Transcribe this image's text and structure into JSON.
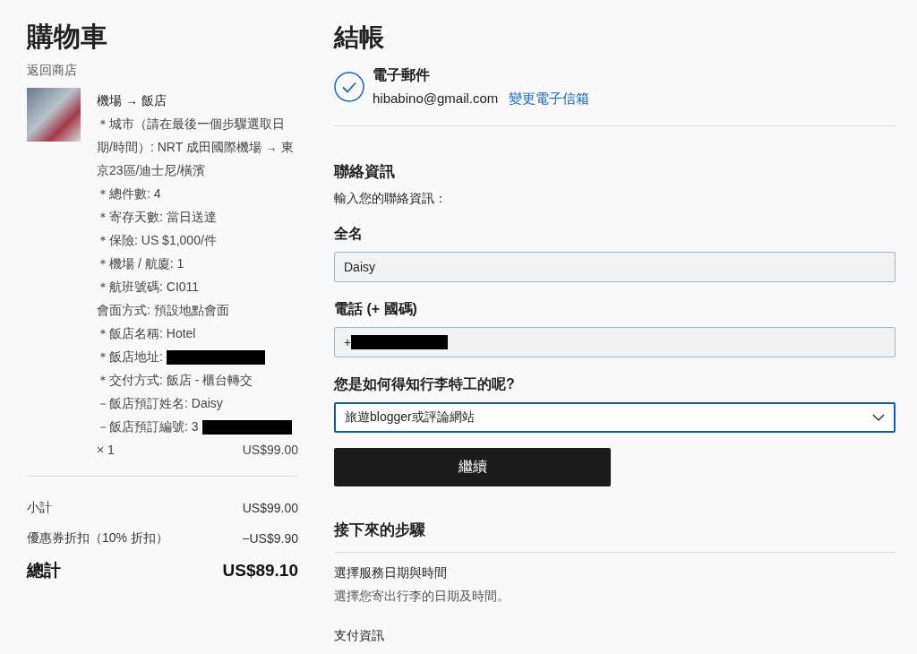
{
  "cart": {
    "title": "購物車",
    "back_link": "返回商店",
    "item": {
      "name": "機場 → 飯店",
      "details": [
        {
          "text": "＊城市（請在最後一個步驟選取日期/時間）: NRT 成田國際機場 → 東京23區/迪士尼/橫濱",
          "redacted": false
        },
        {
          "text": "＊總件數: 4",
          "redacted": false
        },
        {
          "text": "＊寄存天數: 當日送達",
          "redacted": false
        },
        {
          "text": "＊保險: US $1,000/件",
          "redacted": false
        },
        {
          "text": "＊機場 / 航廈: 1",
          "redacted": false
        },
        {
          "text": "＊航班號碼: CI011",
          "redacted": false
        },
        {
          "text": "會面方式: 預設地點會面",
          "redacted": false
        },
        {
          "text": "＊飯店名稱: Hotel",
          "redacted": false
        },
        {
          "text": "＊飯店地址:",
          "redacted": true
        },
        {
          "text": "＊交付方式: 飯店 - 櫃台轉交",
          "redacted": false
        },
        {
          "text": "－飯店預訂姓名: Daisy",
          "redacted": false
        },
        {
          "text": "－飯店預訂編號: 3",
          "redacted": true
        }
      ],
      "quantity": "× 1",
      "price": "US$99.00"
    },
    "summary": [
      {
        "kind": "normal",
        "label": "小計",
        "value": "US$99.00"
      },
      {
        "kind": "normal",
        "label": "優惠券折扣（10% 折扣）",
        "value": "−US$9.90"
      },
      {
        "kind": "total",
        "label": "總計",
        "value": "US$89.10"
      }
    ]
  },
  "checkout": {
    "title": "結帳",
    "email": {
      "heading": "電子郵件",
      "address": "hibabino@gmail.com",
      "change_link": "變更電子信箱",
      "done": true
    },
    "contact": {
      "heading": "聯絡資訊",
      "subtitle": "輸入您的聯絡資訊：",
      "fields": [
        {
          "kind": "text",
          "label": "全名",
          "value": "Daisy",
          "redacted": false
        },
        {
          "kind": "text",
          "label": "電話 (+ 國碼)",
          "value": "+",
          "redacted": true
        },
        {
          "kind": "select",
          "label": "您是如何得知行李特工的呢?",
          "value": "旅遊blogger或評論網站",
          "redacted": false
        }
      ],
      "button": "繼續"
    },
    "next_steps": {
      "heading": "接下來的步驟",
      "steps": [
        {
          "title": "選擇服務日期與時間",
          "description": "選擇您寄出行李的日期及時間。"
        },
        {
          "title": "支付資訊"
        }
      ]
    }
  }
}
